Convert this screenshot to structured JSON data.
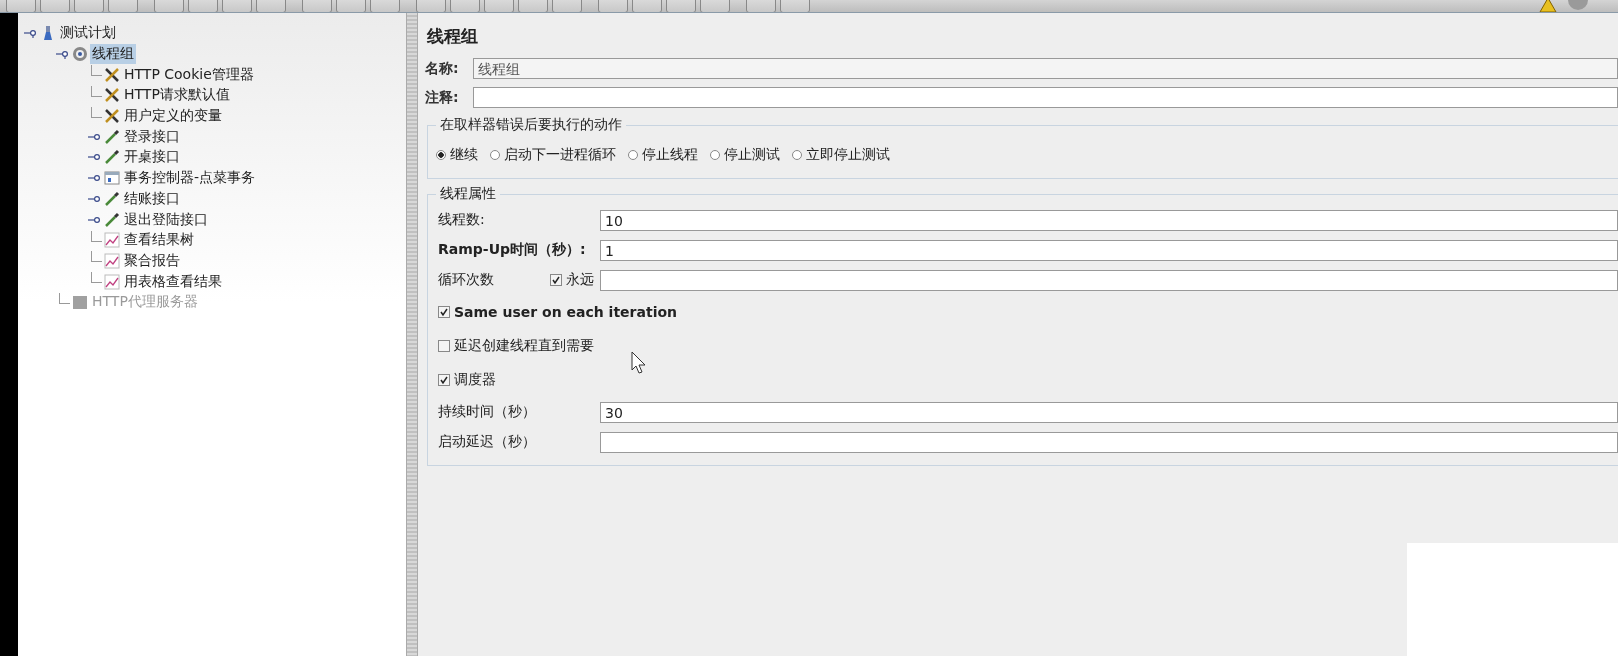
{
  "tree": [
    {
      "label": "测试计划",
      "kind": "plan",
      "selected": false,
      "disabled": false,
      "expanded": true,
      "children": [
        {
          "label": "线程组",
          "kind": "threadgroup",
          "selected": true,
          "disabled": false,
          "expanded": true,
          "children": [
            {
              "label": "HTTP Cookie管理器",
              "kind": "config",
              "selected": false,
              "disabled": false
            },
            {
              "label": "HTTP请求默认值",
              "kind": "config",
              "selected": false,
              "disabled": false
            },
            {
              "label": "用户定义的变量",
              "kind": "config",
              "selected": false,
              "disabled": false
            },
            {
              "label": "登录接口",
              "kind": "sampler",
              "selected": false,
              "disabled": false,
              "expanded": false
            },
            {
              "label": "开桌接口",
              "kind": "sampler",
              "selected": false,
              "disabled": false,
              "expanded": false
            },
            {
              "label": "事务控制器-点菜事务",
              "kind": "controller",
              "selected": false,
              "disabled": false,
              "expanded": false
            },
            {
              "label": "结账接口",
              "kind": "sampler",
              "selected": false,
              "disabled": false,
              "expanded": false
            },
            {
              "label": "退出登陆接口",
              "kind": "sampler",
              "selected": false,
              "disabled": false,
              "expanded": false
            },
            {
              "label": "查看结果树",
              "kind": "listener",
              "selected": false,
              "disabled": false
            },
            {
              "label": "聚合报告",
              "kind": "listener",
              "selected": false,
              "disabled": false
            },
            {
              "label": "用表格查看结果",
              "kind": "listener",
              "selected": false,
              "disabled": false
            }
          ]
        },
        {
          "label": "HTTP代理服务器",
          "kind": "proxy",
          "selected": false,
          "disabled": true
        }
      ]
    }
  ],
  "panel": {
    "title": "线程组",
    "name": {
      "label": "名称:",
      "value": "线程组"
    },
    "comment": {
      "label": "注释:"
    },
    "error_action": {
      "title": "在取样器错误后要执行的动作",
      "options": [
        {
          "label": "继续",
          "selected": true
        },
        {
          "label": "启动下一进程循环",
          "selected": false
        },
        {
          "label": "停止线程",
          "selected": false
        },
        {
          "label": "停止测试",
          "selected": false
        },
        {
          "label": "立即停止测试",
          "selected": false
        }
      ]
    },
    "thread_properties": {
      "title": "线程属性",
      "rows": [
        {
          "kind": "field",
          "label": "线程数:",
          "value": "10",
          "bold": false
        },
        {
          "kind": "field",
          "label": "Ramp-Up时间（秒）:",
          "value": "1",
          "bold": true
        },
        {
          "kind": "loop",
          "label": "循环次数",
          "check_label": "永远",
          "checked": true
        },
        {
          "kind": "check",
          "label": "Same user on each iteration",
          "checked": true,
          "bold": true
        },
        {
          "kind": "check",
          "label": "延迟创建线程直到需要",
          "checked": false,
          "bold": false
        },
        {
          "kind": "check",
          "label": "调度器",
          "checked": true,
          "bold": false
        },
        {
          "kind": "field",
          "label": "持续时间（秒）",
          "value": "30",
          "bold": false
        },
        {
          "kind": "field",
          "label": "启动延迟（秒）",
          "bold": false
        }
      ]
    }
  }
}
